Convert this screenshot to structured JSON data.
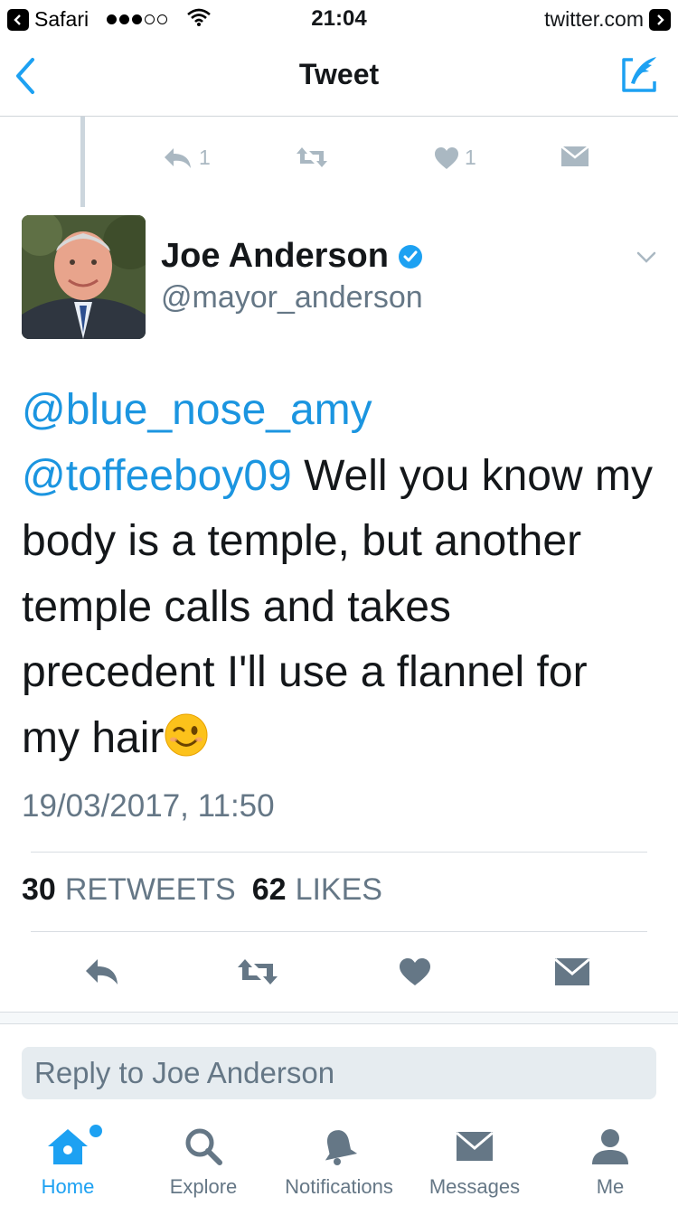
{
  "status_bar": {
    "back_app": "Safari",
    "time": "21:04",
    "site": "twitter.com"
  },
  "nav": {
    "title": "Tweet"
  },
  "previous_tweet": {
    "reply_count": "1",
    "like_count": "1"
  },
  "tweet": {
    "author_name": "Joe Anderson",
    "author_handle": "@mayor_anderson",
    "mention_1": "@blue_nose_amy",
    "mention_2": "@toffeeboy09",
    "text_part_1": " Well you know my body is a temple, but another temple calls and takes precedent I'll use a flannel for my hair",
    "timestamp": "19/03/2017, 11:50",
    "retweets_count": "30",
    "retweets_label": "RETWEETS",
    "likes_count": "62",
    "likes_label": "LIKES"
  },
  "reply": {
    "placeholder": "Reply to Joe Anderson"
  },
  "tabs": [
    {
      "label": "Home",
      "icon": "home-icon"
    },
    {
      "label": "Explore",
      "icon": "search-icon"
    },
    {
      "label": "Notifications",
      "icon": "bell-icon"
    },
    {
      "label": "Messages",
      "icon": "envelope-icon"
    },
    {
      "label": "Me",
      "icon": "person-icon"
    }
  ],
  "colors": {
    "accent": "#1da1f2",
    "mention": "#1b95e0",
    "secondary_text": "#657786"
  }
}
